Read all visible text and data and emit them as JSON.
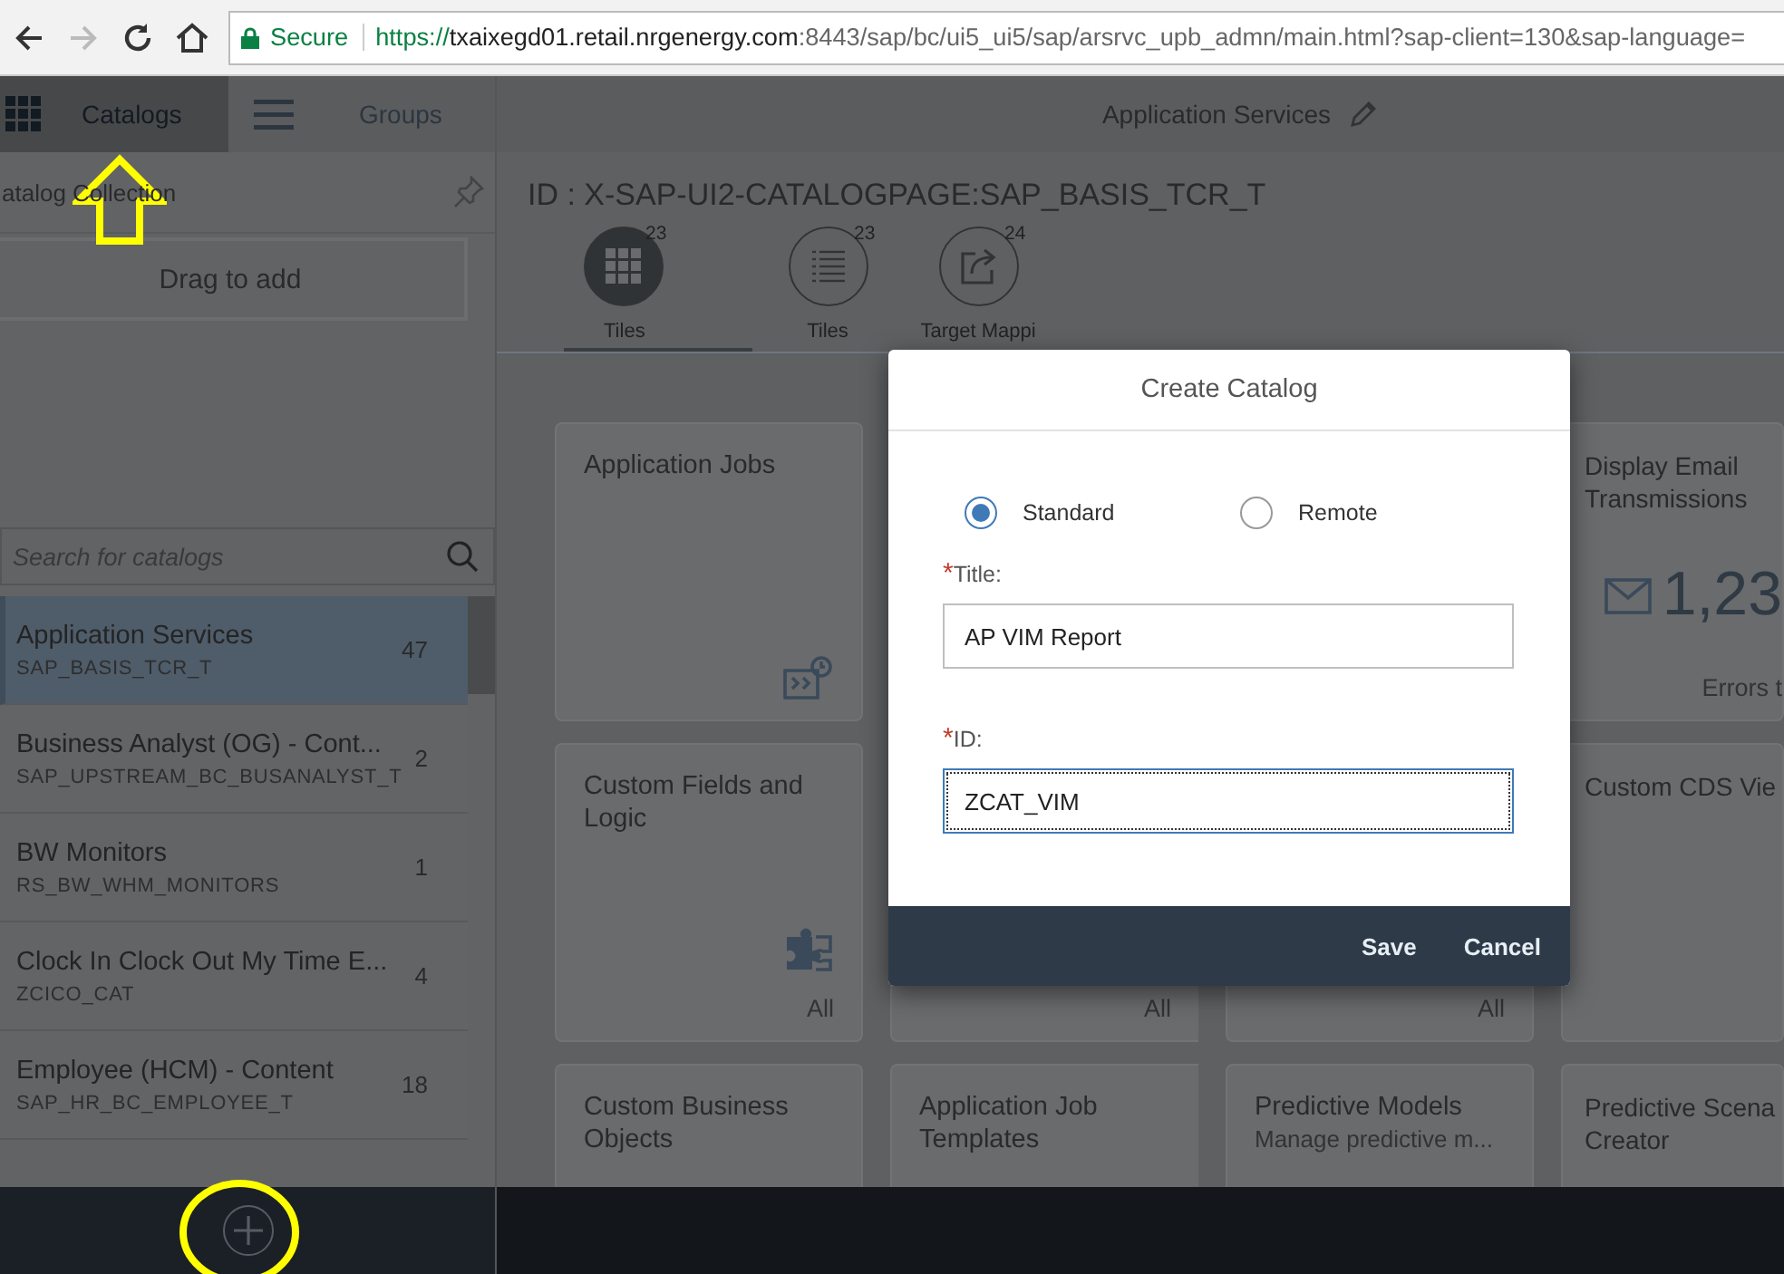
{
  "browser": {
    "forward_disabled": true,
    "secure_label": "Secure",
    "url_scheme": "https://",
    "url_host": "txaixegd01.retail.nrgenergy.com",
    "url_path": ":8443/sap/bc/ui5_ui5/sap/arsrvc_upb_admn/main.html?sap-client=130&sap-language="
  },
  "header": {
    "tabs": [
      {
        "label": "Catalogs",
        "selected": true
      },
      {
        "label": "Groups",
        "selected": false
      }
    ],
    "title": "Application Services"
  },
  "sidebar": {
    "collection_label": "atalog Collection",
    "drop_zone": "Drag to add",
    "search": {
      "placeholder": "Search for catalogs"
    },
    "catalogs": [
      {
        "title": "Application Services",
        "id": "SAP_BASIS_TCR_T",
        "count": "47",
        "selected": true
      },
      {
        "title": "Business Analyst (OG) - Cont...",
        "id": "SAP_UPSTREAM_BC_BUSANALYST_T",
        "count": "2",
        "selected": false
      },
      {
        "title": "BW Monitors",
        "id": "RS_BW_WHM_MONITORS",
        "count": "1",
        "selected": false
      },
      {
        "title": "Clock In Clock Out My Time E...",
        "id": "ZCICO_CAT",
        "count": "4",
        "selected": false
      },
      {
        "title": "Employee (HCM) - Content",
        "id": "SAP_HR_BC_EMPLOYEE_T",
        "count": "18",
        "selected": false
      }
    ]
  },
  "content": {
    "heading": "ID : X-SAP-UI2-CATALOGPAGE:SAP_BASIS_TCR_T",
    "view_tabs": [
      {
        "label": "Tiles",
        "count": "23",
        "selected": true
      },
      {
        "label": "Tiles",
        "count": "23",
        "selected": false
      },
      {
        "label": "Target Mappi",
        "count": "24",
        "selected": false
      }
    ],
    "tile_rows": [
      {
        "tiles": [
          {
            "title": "Application Jobs"
          },
          {
            "title": "Display Email Transmissions",
            "kpi": "1,23",
            "footer": "Errors t"
          }
        ]
      },
      {
        "tiles": [
          {
            "title": "Custom Fields and Logic",
            "footer": "All"
          },
          {
            "footer": "All"
          },
          {
            "footer": "All"
          },
          {
            "title": "Custom CDS Vie"
          }
        ]
      },
      {
        "tiles": [
          {
            "title": "Custom Business Objects"
          },
          {
            "title": "Application Job Templates"
          },
          {
            "title": "Predictive Models",
            "subtitle": "Manage predictive m..."
          },
          {
            "title": "Predictive Scena\nCreator"
          }
        ]
      }
    ]
  },
  "dialog": {
    "title": "Create Catalog",
    "options": [
      {
        "label": "Standard",
        "selected": true
      },
      {
        "label": "Remote",
        "selected": false
      }
    ],
    "fields": [
      {
        "marker": "*",
        "label": "Title:",
        "value": "AP VIM Report",
        "focused": false
      },
      {
        "marker": "*",
        "label": "ID:",
        "value": "ZCAT_VIM",
        "focused": true
      }
    ],
    "buttons": [
      "Save",
      "Cancel"
    ]
  }
}
